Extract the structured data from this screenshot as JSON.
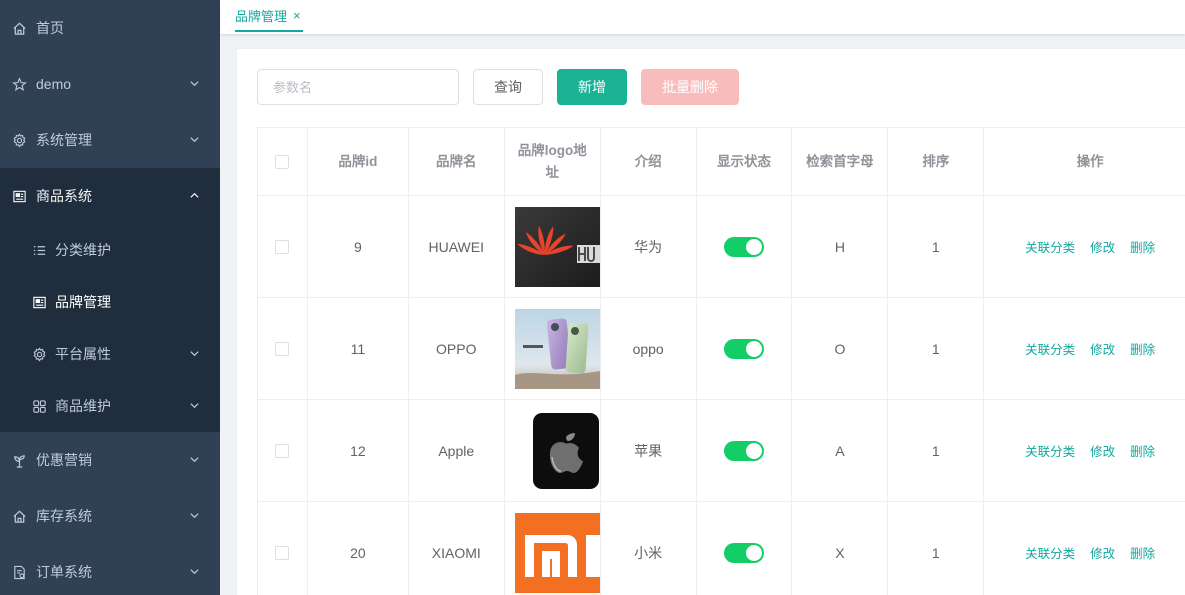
{
  "sidebar": {
    "items": [
      {
        "label": "首页",
        "icon": "home-icon"
      },
      {
        "label": "demo",
        "icon": "star-icon"
      },
      {
        "label": "系统管理",
        "icon": "gear-icon"
      },
      {
        "label": "商品系统",
        "icon": "document-icon"
      },
      {
        "label": "优惠营销",
        "icon": "plant-icon"
      },
      {
        "label": "库存系统",
        "icon": "house-icon"
      },
      {
        "label": "订单系统",
        "icon": "order-icon"
      }
    ],
    "sub_items": [
      {
        "label": "分类维护",
        "icon": "list-icon"
      },
      {
        "label": "品牌管理",
        "icon": "document-icon"
      },
      {
        "label": "平台属性",
        "icon": "gear-icon"
      },
      {
        "label": "商品维护",
        "icon": "grid-icon"
      }
    ]
  },
  "tabs": [
    {
      "label": "品牌管理",
      "close": "×"
    }
  ],
  "toolbar": {
    "search_placeholder": "参数名",
    "search_value": "",
    "query_label": "查询",
    "add_label": "新增",
    "batch_delete_label": "批量删除"
  },
  "table": {
    "headers": [
      "品牌id",
      "品牌名",
      "品牌logo地址",
      "介绍",
      "显示状态",
      "检索首字母",
      "排序",
      "操作"
    ],
    "rows": [
      {
        "id": "9",
        "name": "HUAWEI",
        "logo": "huawei-logo",
        "intro": "华为",
        "show_status": true,
        "first_letter": "H",
        "sort": "1"
      },
      {
        "id": "11",
        "name": "OPPO",
        "logo": "oppo-logo",
        "intro": "oppo",
        "show_status": true,
        "first_letter": "O",
        "sort": "1"
      },
      {
        "id": "12",
        "name": "Apple",
        "logo": "apple-logo",
        "intro": "苹果",
        "show_status": true,
        "first_letter": "A",
        "sort": "1"
      },
      {
        "id": "20",
        "name": "XIAOMI",
        "logo": "xiaomi-logo",
        "intro": "小米",
        "show_status": true,
        "first_letter": "X",
        "sort": "1"
      }
    ],
    "ops": {
      "relate": "关联分类",
      "edit": "修改",
      "delete": "删除"
    }
  },
  "colors": {
    "sidebar_bg": "#304156",
    "submenu_bg": "#1f2d3d",
    "accent": "#13a89e",
    "switch_on": "#13ce66",
    "add_button": "#1ab394",
    "batch_delete_disabled": "#f9bcbc"
  }
}
